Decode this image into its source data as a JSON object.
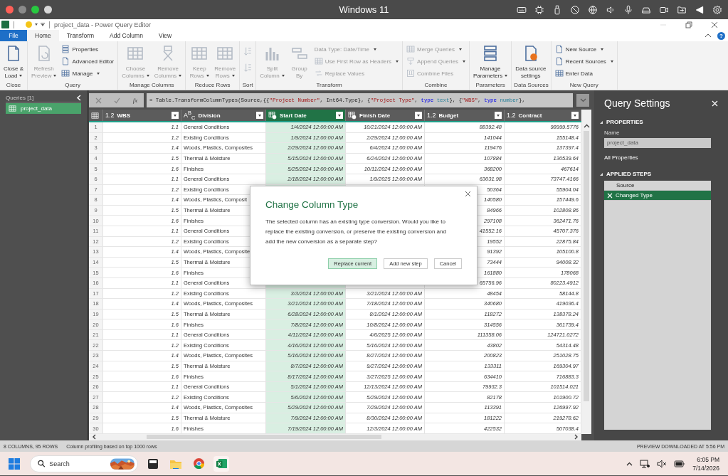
{
  "mac_bar": {
    "title": "Windows 11"
  },
  "app": {
    "title": "project_data - Power Query Editor",
    "help": "?"
  },
  "ribbon_tabs": [
    {
      "label": "File",
      "kind": "file",
      "selected": false
    },
    {
      "label": "Home",
      "kind": "tab",
      "selected": true
    },
    {
      "label": "Transform",
      "kind": "tab",
      "selected": false
    },
    {
      "label": "Add Column",
      "kind": "tab",
      "selected": false
    },
    {
      "label": "View",
      "kind": "tab",
      "selected": false
    }
  ],
  "ribbon_groups": [
    {
      "label": "Close",
      "buttons": [
        {
          "label": "Close &\nLoad",
          "kind": "large",
          "menu": true,
          "disabled": false
        }
      ]
    },
    {
      "label": "Query",
      "buttons": [
        {
          "label": "Refresh\nPreview",
          "kind": "large",
          "menu": true,
          "disabled": true
        },
        {
          "label": "Properties",
          "kind": "small",
          "menu": false,
          "disabled": false
        },
        {
          "label": "Advanced Editor",
          "kind": "small",
          "menu": false,
          "disabled": false
        },
        {
          "label": "Manage",
          "kind": "small",
          "menu": true,
          "disabled": false
        }
      ]
    },
    {
      "label": "Manage Columns",
      "buttons": [
        {
          "label": "Choose\nColumns",
          "kind": "large",
          "menu": true,
          "disabled": true
        },
        {
          "label": "Remove\nColumns",
          "kind": "large",
          "menu": true,
          "disabled": true
        }
      ]
    },
    {
      "label": "Reduce Rows",
      "buttons": [
        {
          "label": "Keep\nRows",
          "kind": "large",
          "menu": true,
          "disabled": true
        },
        {
          "label": "Remove\nRows",
          "kind": "large",
          "menu": true,
          "disabled": true
        }
      ]
    },
    {
      "label": "Sort",
      "buttons": [
        {
          "kind": "icon",
          "disabled": true
        },
        {
          "kind": "icon",
          "disabled": true
        }
      ]
    },
    {
      "label": "Transform",
      "buttons": [
        {
          "label": "Split\nColumn",
          "kind": "large",
          "menu": true,
          "disabled": true
        },
        {
          "label": "Group\nBy",
          "kind": "large",
          "menu": false,
          "disabled": true
        },
        {
          "label": "Data Type: Date/Time",
          "kind": "small",
          "menu": true,
          "disabled": true
        },
        {
          "label": "Use First Row as Headers",
          "kind": "small",
          "menu": true,
          "disabled": true
        },
        {
          "label": "Replace Values",
          "kind": "small",
          "menu": false,
          "disabled": true
        }
      ]
    },
    {
      "label": "Combine",
      "buttons": [
        {
          "label": "Merge Queries",
          "kind": "small",
          "menu": true,
          "disabled": true
        },
        {
          "label": "Append Queries",
          "kind": "small",
          "menu": true,
          "disabled": true
        },
        {
          "label": "Combine Files",
          "kind": "small",
          "menu": false,
          "disabled": true
        }
      ]
    },
    {
      "label": "Parameters",
      "buttons": [
        {
          "label": "Manage\nParameters",
          "kind": "large",
          "menu": true,
          "disabled": false
        }
      ]
    },
    {
      "label": "Data Sources",
      "buttons": [
        {
          "label": "Data source\nsettings",
          "kind": "large",
          "menu": false,
          "disabled": false
        }
      ]
    },
    {
      "label": "New Query",
      "buttons": [
        {
          "label": "New Source",
          "kind": "small",
          "menu": true,
          "disabled": false
        },
        {
          "label": "Recent Sources",
          "kind": "small",
          "menu": true,
          "disabled": false
        },
        {
          "label": "Enter Data",
          "kind": "small",
          "menu": false,
          "disabled": false
        }
      ]
    }
  ],
  "queries": {
    "header": "Queries [1]",
    "items": [
      {
        "name": "project_data",
        "selected": true
      }
    ]
  },
  "formula": {
    "fx": "fx",
    "tokens": [
      {
        "text": "= Table.TransformColumnTypes(Source,{{",
        "kind": "plain"
      },
      {
        "text": "\"Project Number\"",
        "kind": "string"
      },
      {
        "text": ", Int64.Type}, {",
        "kind": "plain"
      },
      {
        "text": "\"Project Type\"",
        "kind": "string"
      },
      {
        "text": ", ",
        "kind": "plain"
      },
      {
        "text": "type ",
        "kind": "keyword"
      },
      {
        "text": "text",
        "kind": "typename"
      },
      {
        "text": "}, {",
        "kind": "plain"
      },
      {
        "text": "\"WBS\"",
        "kind": "string"
      },
      {
        "text": ", ",
        "kind": "plain"
      },
      {
        "text": "type ",
        "kind": "keyword"
      },
      {
        "text": "number",
        "kind": "typename"
      },
      {
        "text": "},",
        "kind": "plain"
      }
    ]
  },
  "columns": [
    {
      "label": "WBS",
      "kind": "number",
      "type_label": "1.2",
      "selected": false
    },
    {
      "label": "Division",
      "kind": "text",
      "type_label": "A$^{B}$$_{C}$",
      "selected": false
    },
    {
      "label": "Start Date",
      "kind": "datetime",
      "selected": true
    },
    {
      "label": "Finish Date",
      "kind": "datetime",
      "selected": false
    },
    {
      "label": "Budget",
      "kind": "number",
      "type_label": "1.2",
      "selected": false
    },
    {
      "label": "Contract",
      "kind": "number",
      "type_label": "1.2",
      "selected": false
    }
  ],
  "rows": [
    {
      "n": "1",
      "wbs": "1.1",
      "division": "General Conditions",
      "start": "1/4/2024 12:00:00 AM",
      "finish": "10/21/2024 12:00:00 AM",
      "budget": "88392.48",
      "contract": "98999.5776"
    },
    {
      "n": "2",
      "wbs": "1.2",
      "division": "Existing Conditions",
      "start": "1/9/2024 12:00:00 AM",
      "finish": "2/29/2024 12:00:00 AM",
      "budget": "141044",
      "contract": "155148.4"
    },
    {
      "n": "3",
      "wbs": "1.4",
      "division": "Woods, Plastics, Composites",
      "start": "2/29/2024 12:00:00 AM",
      "finish": "6/4/2024 12:00:00 AM",
      "budget": "119476",
      "contract": "137397.4"
    },
    {
      "n": "4",
      "wbs": "1.5",
      "division": "Thermal & Moisture",
      "start": "5/15/2024 12:00:00 AM",
      "finish": "6/24/2024 12:00:00 AM",
      "budget": "107884",
      "contract": "130539.64"
    },
    {
      "n": "5",
      "wbs": "1.6",
      "division": "Finishes",
      "start": "5/25/2024 12:00:00 AM",
      "finish": "10/11/2024 12:00:00 AM",
      "budget": "368200",
      "contract": "467614"
    },
    {
      "n": "6",
      "wbs": "1.1",
      "division": "General Conditions",
      "start": "2/18/2024 12:00:00 AM",
      "finish": "1/9/2025 12:00:00 AM",
      "budget": "63031.98",
      "contract": "73747.4166"
    },
    {
      "n": "7",
      "wbs": "1.2",
      "division": "Existing Conditions",
      "budget": "50364",
      "contract": "55904.04"
    },
    {
      "n": "8",
      "wbs": "1.4",
      "division": "Woods, Plastics, Composit",
      "budget": "140580",
      "contract": "157449.6"
    },
    {
      "n": "9",
      "wbs": "1.5",
      "division": "Thermal & Moisture",
      "budget": "84966",
      "contract": "102808.86"
    },
    {
      "n": "10",
      "wbs": "1.6",
      "division": "Finishes",
      "budget": "297108",
      "contract": "362471.76"
    },
    {
      "n": "11",
      "wbs": "1.1",
      "division": "General Conditions",
      "budget": "41552.16",
      "contract": "45707.376"
    },
    {
      "n": "12",
      "wbs": "1.2",
      "division": "Existing Conditions",
      "budget": "19552",
      "contract": "22875.84"
    },
    {
      "n": "13",
      "wbs": "1.4",
      "division": "Woods, Plastics, Composite",
      "budget": "91392",
      "contract": "105100.8"
    },
    {
      "n": "14",
      "wbs": "1.5",
      "division": "Thermal & Moisture",
      "budget": "73444",
      "contract": "94008.32"
    },
    {
      "n": "15",
      "wbs": "1.6",
      "division": "Finishes",
      "budget": "161880",
      "contract": "178068"
    },
    {
      "n": "16",
      "wbs": "1.1",
      "division": "General Conditions",
      "budget": "65756.96",
      "contract": "80223.4912"
    },
    {
      "n": "17",
      "wbs": "1.2",
      "division": "Existing Conditions",
      "start": "3/3/2024 12:00:00 AM",
      "finish": "3/21/2024 12:00:00 AM",
      "budget": "48454",
      "contract": "58144.8"
    },
    {
      "n": "18",
      "wbs": "1.4",
      "division": "Woods, Plastics, Composites",
      "start": "3/21/2024 12:00:00 AM",
      "finish": "7/18/2024 12:00:00 AM",
      "budget": "340680",
      "contract": "419036.4"
    },
    {
      "n": "19",
      "wbs": "1.5",
      "division": "Thermal & Moisture",
      "start": "6/28/2024 12:00:00 AM",
      "finish": "8/1/2024 12:00:00 AM",
      "budget": "118272",
      "contract": "138378.24"
    },
    {
      "n": "20",
      "wbs": "1.6",
      "division": "Finishes",
      "start": "7/8/2024 12:00:00 AM",
      "finish": "10/8/2024 12:00:00 AM",
      "budget": "314556",
      "contract": "361739.4"
    },
    {
      "n": "21",
      "wbs": "1.1",
      "division": "General Conditions",
      "start": "4/11/2024 12:00:00 AM",
      "finish": "4/6/2025 12:00:00 AM",
      "budget": "111358.06",
      "contract": "124721.0272"
    },
    {
      "n": "22",
      "wbs": "1.2",
      "division": "Existing Conditions",
      "start": "4/16/2024 12:00:00 AM",
      "finish": "5/16/2024 12:00:00 AM",
      "budget": "43802",
      "contract": "54314.48"
    },
    {
      "n": "23",
      "wbs": "1.4",
      "division": "Woods, Plastics, Composites",
      "start": "5/16/2024 12:00:00 AM",
      "finish": "8/27/2024 12:00:00 AM",
      "budget": "200823",
      "contract": "251028.75"
    },
    {
      "n": "24",
      "wbs": "1.5",
      "division": "Thermal & Moisture",
      "start": "8/7/2024 12:00:00 AM",
      "finish": "9/27/2024 12:00:00 AM",
      "budget": "133311",
      "contract": "169304.97"
    },
    {
      "n": "25",
      "wbs": "1.6",
      "division": "Finishes",
      "start": "8/17/2024 12:00:00 AM",
      "finish": "3/27/2025 12:00:00 AM",
      "budget": "634410",
      "contract": "716883.3"
    },
    {
      "n": "26",
      "wbs": "1.1",
      "division": "General Conditions",
      "start": "5/1/2024 12:00:00 AM",
      "finish": "12/13/2024 12:00:00 AM",
      "budget": "79932.3",
      "contract": "101514.021"
    },
    {
      "n": "27",
      "wbs": "1.2",
      "division": "Existing Conditions",
      "start": "5/6/2024 12:00:00 AM",
      "finish": "5/29/2024 12:00:00 AM",
      "budget": "82178",
      "contract": "101900.72"
    },
    {
      "n": "28",
      "wbs": "1.4",
      "division": "Woods, Plastics, Composites",
      "start": "5/29/2024 12:00:00 AM",
      "finish": "7/29/2024 12:00:00 AM",
      "budget": "113391",
      "contract": "126997.92"
    },
    {
      "n": "29",
      "wbs": "1.5",
      "division": "Thermal & Moisture",
      "start": "7/9/2024 12:00:00 AM",
      "finish": "8/30/2024 12:00:00 AM",
      "budget": "181222",
      "contract": "219278.62"
    },
    {
      "n": "30",
      "wbs": "1.6",
      "division": "Finishes",
      "start": "7/19/2024 12:00:00 AM",
      "finish": "12/3/2024 12:00:00 AM",
      "budget": "422532",
      "contract": "507038.4"
    }
  ],
  "query_settings": {
    "title": "Query Settings",
    "properties_heading": "PROPERTIES",
    "name_label": "Name",
    "name_value": "project_data",
    "all_properties": "All Properties",
    "steps_heading": "APPLIED STEPS",
    "steps": [
      {
        "label": "Source",
        "selected": false
      },
      {
        "label": "Changed Type",
        "selected": true
      }
    ]
  },
  "dialog": {
    "title": "Change Column Type",
    "message": "The selected column has an existing type conversion. Would you like to replace the existing conversion, or preserve the existing conversion and add the new conversion as a separate step?",
    "buttons": [
      {
        "label": "Replace current",
        "default": true
      },
      {
        "label": "Add new step",
        "default": false
      },
      {
        "label": "Cancel",
        "default": false
      }
    ]
  },
  "status_bar": {
    "columns_rows": "8 COLUMNS, 95 ROWS",
    "profiling": "Column profiling based on top 1000 rows",
    "preview": "PREVIEW DOWNLOADED AT 5:56 PM"
  },
  "taskbar": {
    "placeholder": "Search",
    "time": "6:05 PM",
    "date": "7/14/2026"
  }
}
